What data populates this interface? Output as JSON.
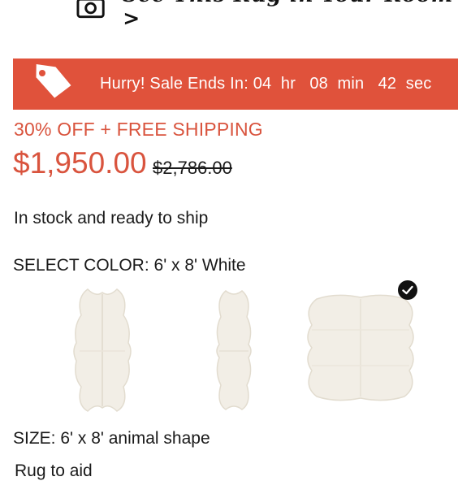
{
  "see_room": {
    "label": "See This Rug in Your Room >",
    "icon": "camera-icon"
  },
  "sale_banner": {
    "icon": "price-tag-icon",
    "text": "Hurry! Sale Ends In: 04  hr   08  min   42  sec",
    "color": "#e0523b"
  },
  "offer": {
    "text": "30% OFF + FREE SHIPPING",
    "color": "#d9543e"
  },
  "pricing": {
    "price": "$1,950.00",
    "compare_at": "$2,786.00"
  },
  "stock": {
    "text": "In stock and ready to ship"
  },
  "color_select": {
    "label": "SELECT COLOR:",
    "value": "6' x 8' White",
    "swatches": [
      {
        "name": "four-pelt rug",
        "selected": false
      },
      {
        "name": "double runner rug",
        "selected": false
      },
      {
        "name": "six-pelt rug",
        "selected": true
      }
    ]
  },
  "size": {
    "label": "SIZE:",
    "value": "6' x 8' animal shape"
  },
  "next_line": {
    "text": "Rug  to  aid"
  }
}
